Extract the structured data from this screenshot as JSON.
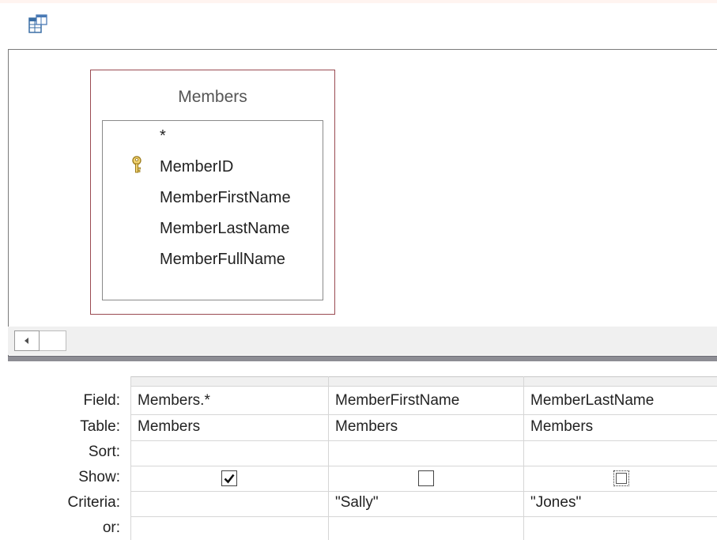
{
  "table": {
    "name": "Members",
    "fields": [
      {
        "label": "*",
        "is_key": false
      },
      {
        "label": "MemberID",
        "is_key": true
      },
      {
        "label": "MemberFirstName",
        "is_key": false
      },
      {
        "label": "MemberLastName",
        "is_key": false
      },
      {
        "label": "MemberFullName",
        "is_key": false
      }
    ]
  },
  "grid": {
    "row_labels": [
      "Field:",
      "Table:",
      "Sort:",
      "Show:",
      "Criteria:",
      "or:"
    ],
    "columns": [
      {
        "field": "Members.*",
        "table": "Members",
        "sort": "",
        "show": true,
        "criteria": "",
        "or": ""
      },
      {
        "field": "MemberFirstName",
        "table": "Members",
        "sort": "",
        "show": false,
        "criteria": "\"Sally\"",
        "or": ""
      },
      {
        "field": "MemberLastName",
        "table": "Members",
        "sort": "",
        "show": false,
        "criteria": "\"Jones\"",
        "or": ""
      }
    ]
  },
  "icons": {
    "query": "query-design-icon",
    "key": "primary-key-icon",
    "scroll_left": "arrow-left-icon"
  }
}
